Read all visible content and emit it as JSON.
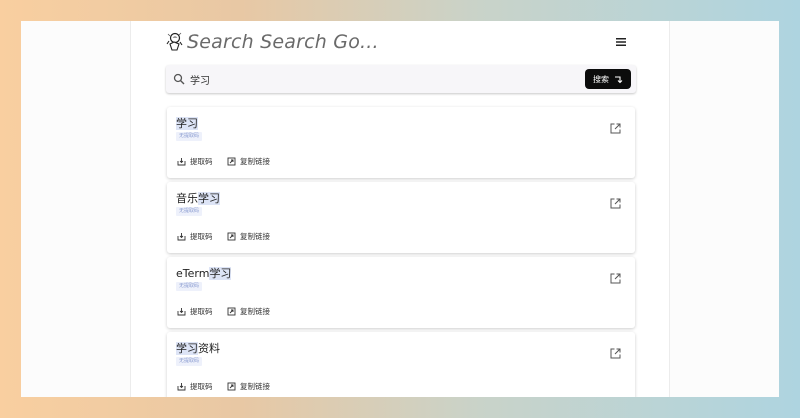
{
  "header": {
    "title": "Search Search Go...",
    "logo_icon": "astronaut-logo-icon",
    "menu_icon": "hamburger-menu-icon"
  },
  "search": {
    "value": "学习",
    "icon": "search-icon",
    "button_label": "搜索",
    "button_icon": "arrow-turn-icon"
  },
  "results": [
    {
      "title_before": "",
      "title_highlight": "学习",
      "title_after": "",
      "tag": "无提取码"
    },
    {
      "title_before": "音乐",
      "title_highlight": "学习",
      "title_after": "",
      "tag": "无提取码"
    },
    {
      "title_before": "eTerm",
      "title_highlight": "学习",
      "title_after": "",
      "tag": "无提取码"
    },
    {
      "title_before": "",
      "title_highlight": "学习",
      "title_after": "资料",
      "tag": "无提取码"
    }
  ],
  "actions": {
    "extract_code_label": "提取码",
    "copy_link_label": "复制链接"
  },
  "colors": {
    "accent_button": "#0c0c0c",
    "highlight_bg": "#dde4f6",
    "tag_bg": "#eef1fb",
    "tag_text": "#8a9bd0"
  }
}
